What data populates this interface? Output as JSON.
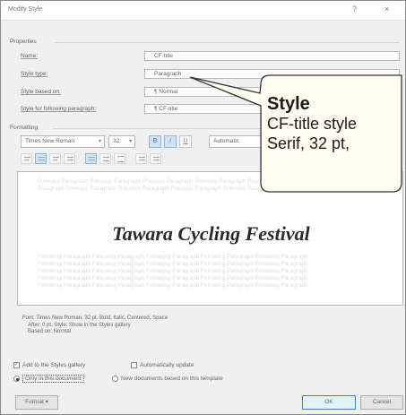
{
  "dialog": {
    "title": "Modify Style",
    "help": "?",
    "close": "×"
  },
  "properties": {
    "section_label": "Properties",
    "rows": [
      {
        "label": "Name:",
        "value": "CF-title"
      },
      {
        "label": "Style type:",
        "value": "Paragraph"
      },
      {
        "label": "Style based on:",
        "value": "¶ Normal"
      },
      {
        "label": "Style for following paragraph:",
        "value": "¶ CF-title"
      }
    ]
  },
  "formatting": {
    "section_label": "Formatting",
    "font": "Times New Roman",
    "size": "32",
    "bold": "B",
    "italic": "I",
    "underline": "U",
    "color": "Automatic"
  },
  "preview": {
    "title": "Tawara Cycling Festival",
    "previous_paragraph_lines": [
      "Previous Paragraph Previous Paragraph Previous Paragraph Previous Paragraph Previous Paragraph Previous",
      "Paragraph Previous Paragraph Previous Paragraph Previous Paragraph Previous Paragraph"
    ],
    "following_paragraph_lines": [
      "Following Paragraph Following Paragraph Following Paragraph Following Paragraph Following Paragraph",
      "Following Paragraph Following Paragraph Following Paragraph Following Paragraph Following Paragraph",
      "Following Paragraph Following Paragraph Following Paragraph Following Paragraph Following Paragraph",
      "Following Paragraph Following Paragraph Following Paragraph Following Paragraph Following Paragraph",
      "Following Paragraph Following Paragraph Following Paragraph Following Paragraph Following Paragraph"
    ]
  },
  "description": [
    "Font: Times New Roman, 32 pt, Bold, Italic, Centered, Space",
    "After: 0 pt, Style: Show in the Styles gallery",
    "Based on: Normal"
  ],
  "options": {
    "add_to_gallery": "Add to the Styles gallery",
    "auto_update": "Automatically update",
    "only_this_document": "Only in this document",
    "new_documents": "New documents based on this template"
  },
  "buttons": {
    "format": "Format ▾",
    "ok": "OK",
    "cancel": "Cancel"
  },
  "callout": {
    "title": "Style",
    "line1": "CF-title style",
    "line2": "Serif, 32 pt,"
  }
}
